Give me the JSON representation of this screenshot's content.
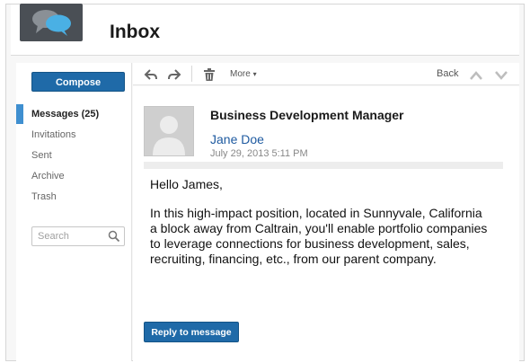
{
  "header": {
    "title": "Inbox",
    "logo_icon": "chat-bubbles-icon"
  },
  "sidebar": {
    "compose_label": "Compose",
    "items": [
      {
        "label": "Messages (25)",
        "active": true
      },
      {
        "label": "Invitations"
      },
      {
        "label": "Sent"
      },
      {
        "label": "Archive"
      },
      {
        "label": "Trash"
      }
    ],
    "search": {
      "placeholder": "Search"
    }
  },
  "toolbar": {
    "reply_icon": "reply-icon",
    "forward_icon": "forward-icon",
    "delete_icon": "trash-icon",
    "more_label": "More",
    "back_label": "Back"
  },
  "message": {
    "subject": "Business Development Manager",
    "sender": "Jane Doe",
    "date": "July 29, 2013 5:11 PM",
    "greeting": "Hello James,",
    "body": "In this high-impact position, located in Sunnyvale, California a block away from Caltrain, you'll enable portfolio companies to leverage connections for business development, sales, recruiting, financing, etc., from our parent company.",
    "reply_label": "Reply to message"
  },
  "colors": {
    "accent": "#1f6aa8",
    "active_indicator": "#3f8fd0",
    "sender_link": "#1e5aa0"
  }
}
